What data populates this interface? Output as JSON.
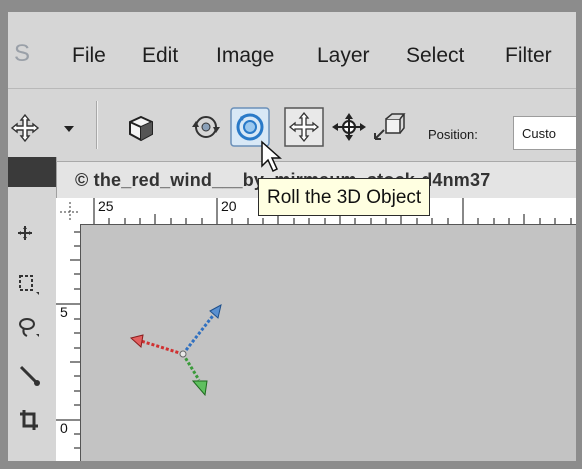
{
  "menu": {
    "logo": "S",
    "items": [
      "File",
      "Edit",
      "Image",
      "Layer",
      "Select",
      "Filter"
    ]
  },
  "options_bar": {
    "icons": [
      "move-tool-icon",
      "dropdown-arrow-icon",
      "3d-object-icon",
      "3d-rotate-icon",
      "3d-roll-icon",
      "3d-pan-icon",
      "3d-slide-icon",
      "3d-scale-icon"
    ],
    "position_label": "Position:",
    "position_value": "Custo"
  },
  "document": {
    "tab_title": "© the_red_wind___by_mirmaum_stock-d4nm37"
  },
  "rulers": {
    "horizontal": [
      "25",
      "20"
    ],
    "vertical": [
      "5",
      "0"
    ]
  },
  "tooltip": {
    "text": "Roll the 3D Object"
  },
  "colors": {
    "x_axis": "#d03030",
    "y_axis": "#3a9a3a",
    "z_axis": "#3070c0",
    "tooltip_bg": "#ffffe1"
  }
}
